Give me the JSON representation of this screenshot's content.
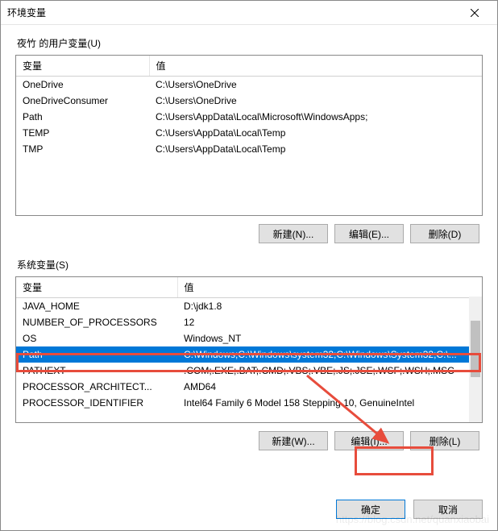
{
  "window": {
    "title": "环境变量"
  },
  "userSection": {
    "label": "夜竹 的用户变量(U)",
    "headers": {
      "name": "变量",
      "value": "值"
    },
    "rows": [
      {
        "name": "OneDrive",
        "value": "C:\\Users\\OneDrive"
      },
      {
        "name": "OneDriveConsumer",
        "value": "C:\\Users\\OneDrive"
      },
      {
        "name": "Path",
        "value": "C:\\Users\\AppData\\Local\\Microsoft\\WindowsApps;"
      },
      {
        "name": "TEMP",
        "value": "C:\\Users\\AppData\\Local\\Temp"
      },
      {
        "name": "TMP",
        "value": "C:\\Users\\AppData\\Local\\Temp"
      }
    ],
    "buttons": {
      "new": "新建(N)...",
      "edit": "编辑(E)...",
      "delete": "删除(D)"
    }
  },
  "systemSection": {
    "label": "系统变量(S)",
    "headers": {
      "name": "变量",
      "value": "值"
    },
    "rows": [
      {
        "name": "JAVA_HOME",
        "value": "D:\\jdk1.8"
      },
      {
        "name": "NUMBER_OF_PROCESSORS",
        "value": "12"
      },
      {
        "name": "OS",
        "value": "Windows_NT"
      },
      {
        "name": "Path",
        "value": "C:\\Windows;C:\\Windows\\system32;C:\\Windows\\System32;C:\\..."
      },
      {
        "name": "PATHEXT",
        "value": ".COM;.EXE;.BAT;.CMD;.VBS;.VBE;.JS;.JSE;.WSF;.WSH;.MSC"
      },
      {
        "name": "PROCESSOR_ARCHITECT...",
        "value": "AMD64"
      },
      {
        "name": "PROCESSOR_IDENTIFIER",
        "value": "Intel64 Family 6 Model 158 Stepping 10, GenuineIntel"
      }
    ],
    "selectedIndex": 3,
    "buttons": {
      "new": "新建(W)...",
      "edit": "编辑(I)...",
      "delete": "删除(L)"
    }
  },
  "dialogButtons": {
    "ok": "确定",
    "cancel": "取消"
  },
  "watermark": "https://blog.csdn.net/quanxiaobai"
}
